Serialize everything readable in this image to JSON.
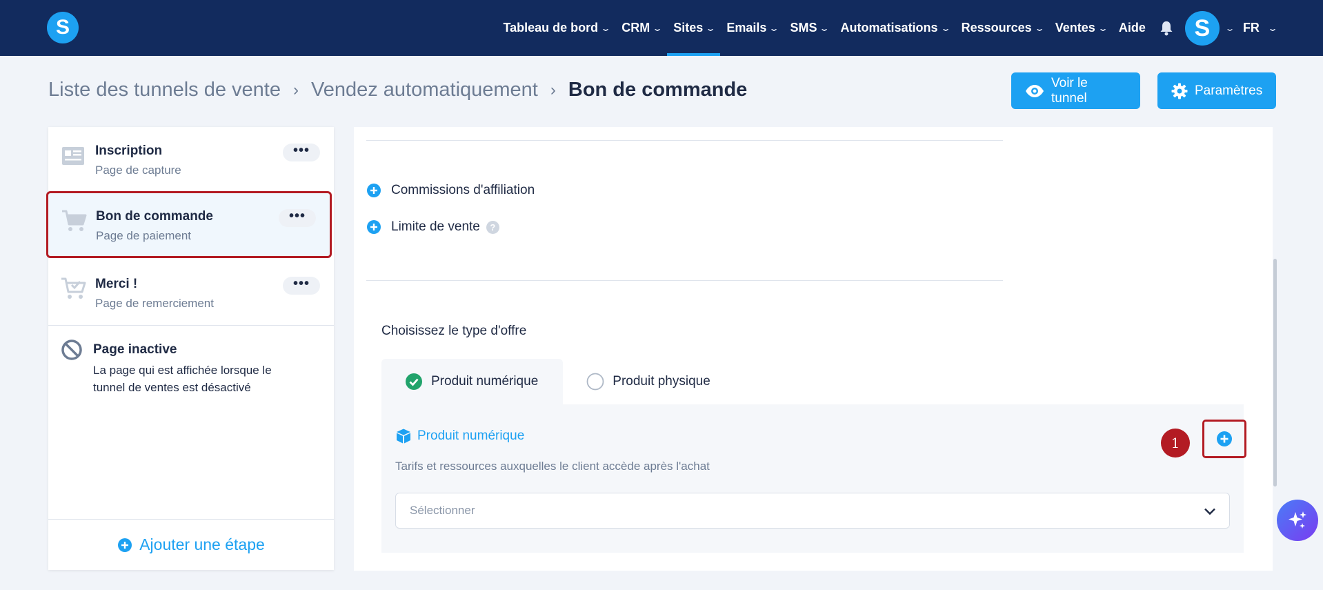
{
  "nav": {
    "logo": "S",
    "items": [
      {
        "label": "Tableau de bord",
        "has_dropdown": true
      },
      {
        "label": "CRM",
        "has_dropdown": true
      },
      {
        "label": "Sites",
        "has_dropdown": true,
        "active": true
      },
      {
        "label": "Emails",
        "has_dropdown": true
      },
      {
        "label": "SMS",
        "has_dropdown": true
      },
      {
        "label": "Automatisations",
        "has_dropdown": true
      },
      {
        "label": "Ressources",
        "has_dropdown": true
      },
      {
        "label": "Ventes",
        "has_dropdown": true
      },
      {
        "label": "Aide",
        "has_dropdown": false
      }
    ],
    "avatar_letter": "S",
    "language": "FR"
  },
  "header": {
    "breadcrumb": [
      "Liste des tunnels de vente",
      "Vendez automatiquement"
    ],
    "current": "Bon de commande",
    "view_button": "Voir le tunnel",
    "settings_button": "Paramètres"
  },
  "sidebar": {
    "steps": [
      {
        "title": "Inscription",
        "subtitle": "Page de capture",
        "icon": "form-icon"
      },
      {
        "title": "Bon de commande",
        "subtitle": "Page de paiement",
        "icon": "cart-icon",
        "selected": true
      },
      {
        "title": "Merci !",
        "subtitle": "Page de remerciement",
        "icon": "cart-check-icon"
      }
    ],
    "more_label": "•••",
    "inactive": {
      "title": "Page inactive",
      "description": "La page qui est affichée lorsque le tunnel de ventes est désactivé"
    },
    "add_step": "Ajouter une étape"
  },
  "main": {
    "options": [
      "Commissions d'affiliation",
      "Limite de vente"
    ],
    "help_mark": "?",
    "offer_type_label": "Choisissez le type d'offre",
    "tabs": [
      {
        "label": "Produit numérique",
        "active": true
      },
      {
        "label": "Produit physique",
        "active": false
      }
    ],
    "product": {
      "title": "Produit numérique",
      "description": "Tarifs et ressources auxquelles le client accède après l'achat",
      "select_placeholder": "Sélectionner",
      "badge": "1"
    }
  },
  "colors": {
    "nav_bg": "#122b5e",
    "accent": "#1da1f2",
    "highlight": "#b31b23",
    "success": "#21a36b"
  }
}
